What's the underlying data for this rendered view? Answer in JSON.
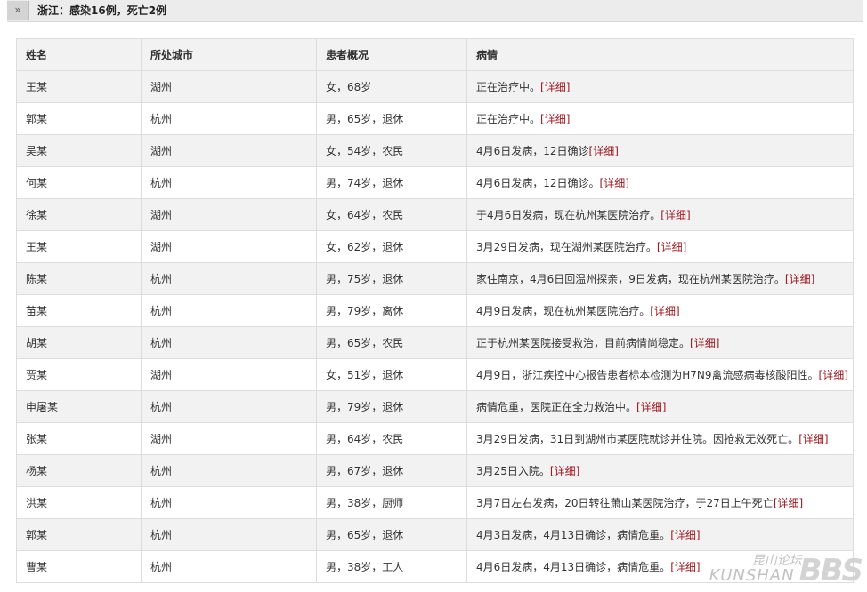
{
  "header": {
    "toggle_glyph": "»",
    "title": "浙江：感染16例，死亡2例"
  },
  "table": {
    "headers": [
      "姓名",
      "所处城市",
      "患者概况",
      "病情"
    ],
    "detail_label": "[详细]",
    "rows": [
      {
        "name": "王某",
        "city": "湖州",
        "profile": "女，68岁",
        "condition": "正在治疗中。"
      },
      {
        "name": "郭某",
        "city": "杭州",
        "profile": "男，65岁，退休",
        "condition": "正在治疗中。"
      },
      {
        "name": "吴某",
        "city": "湖州",
        "profile": "女，54岁，农民",
        "condition": "4月6日发病，12日确诊"
      },
      {
        "name": "何某",
        "city": "杭州",
        "profile": "男，74岁，退休",
        "condition": "4月6日发病，12日确诊。"
      },
      {
        "name": "徐某",
        "city": "湖州",
        "profile": "女，64岁，农民",
        "condition": "于4月6日发病，现在杭州某医院治疗。"
      },
      {
        "name": "王某",
        "city": "湖州",
        "profile": "女，62岁，退休",
        "condition": "3月29日发病，现在湖州某医院治疗。"
      },
      {
        "name": "陈某",
        "city": "杭州",
        "profile": "男，75岁，退休",
        "condition": "家住南京，4月6日回温州探亲，9日发病，现在杭州某医院治疗。"
      },
      {
        "name": "苗某",
        "city": "杭州",
        "profile": "男，79岁，离休",
        "condition": "4月9日发病，现在杭州某医院治疗。"
      },
      {
        "name": "胡某",
        "city": "杭州",
        "profile": "男，65岁，农民",
        "condition": "正于杭州某医院接受救治，目前病情尚稳定。"
      },
      {
        "name": "贾某",
        "city": "湖州",
        "profile": "女，51岁，退休",
        "condition": "4月9日，浙江疾控中心报告患者标本检测为H7N9禽流感病毒核酸阳性。"
      },
      {
        "name": "申屠某",
        "city": "杭州",
        "profile": "男，79岁，退休",
        "condition": "病情危重，医院正在全力救治中。"
      },
      {
        "name": "张某",
        "city": "湖州",
        "profile": "男，64岁，农民",
        "condition": "3月29日发病，31日到湖州市某医院就诊并住院。因抢救无效死亡。"
      },
      {
        "name": "杨某",
        "city": "杭州",
        "profile": "男，67岁，退休",
        "condition": "3月25日入院。"
      },
      {
        "name": "洪某",
        "city": "杭州",
        "profile": "男，38岁，厨师",
        "condition": "3月7日左右发病，20日转往萧山某医院治疗，于27日上午死亡"
      },
      {
        "name": "郭某",
        "city": "杭州",
        "profile": "男，65岁，退休",
        "condition": "4月3日发病，4月13日确诊，病情危重。"
      },
      {
        "name": "曹某",
        "city": "杭州",
        "profile": "男，38岁，工人",
        "condition": "4月6日发病，4月13日确诊，病情危重。"
      }
    ]
  },
  "watermark": {
    "cn": "昆山论坛",
    "en": "KUNSHAN",
    "bbs": "BBS"
  }
}
